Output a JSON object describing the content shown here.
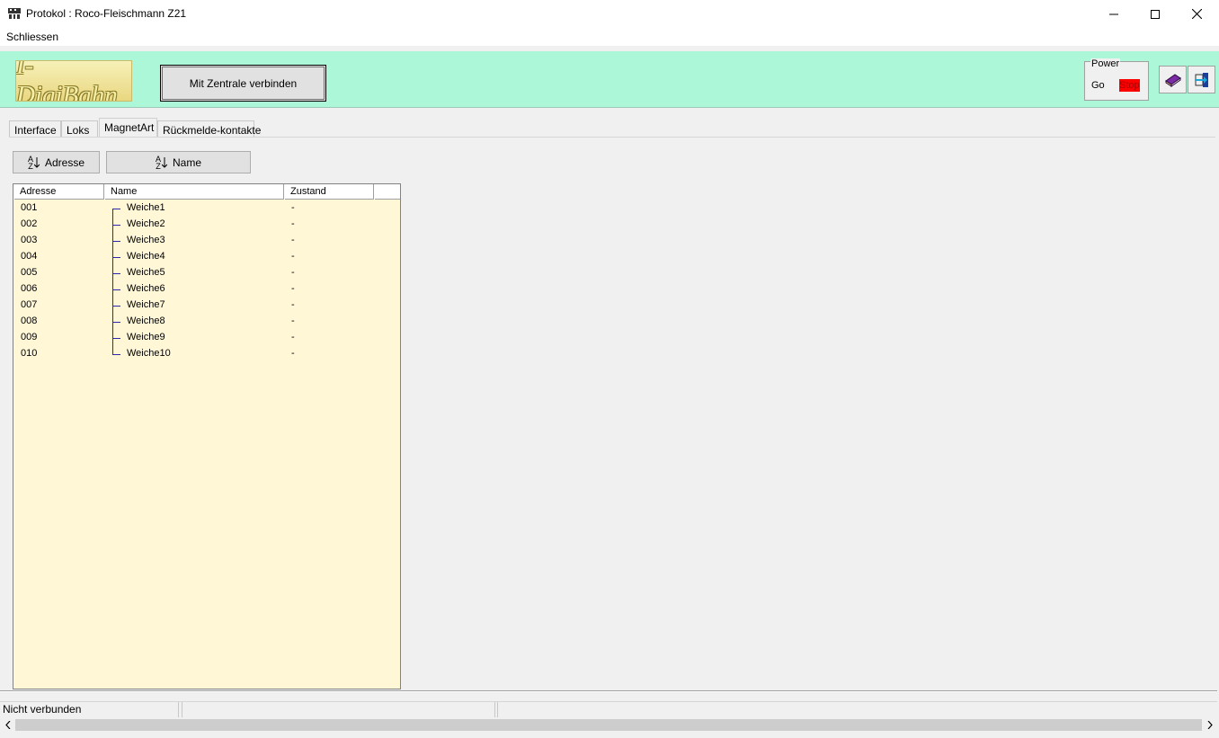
{
  "window": {
    "title": "Protokol : Roco-Fleischmann Z21",
    "min_icon": "minimize-icon",
    "max_icon": "maximize-icon",
    "close_icon": "close-icon"
  },
  "menu": {
    "schliessen": "Schliessen"
  },
  "header": {
    "logo_text": "I-DigiBahn",
    "connect_button": "Mit Zentrale verbinden",
    "power_label": "Power",
    "power_go": "Go",
    "power_stop": "Stop",
    "book_icon": "book-icon",
    "exit_icon": "exit-door-icon",
    "accent_color": "#adf7d9",
    "stop_color": "#ff0000"
  },
  "tabs": [
    {
      "label": "Interface"
    },
    {
      "label": "Loks"
    },
    {
      "label": "MagnetArt",
      "active": true
    },
    {
      "label": "Rückmelde-kontakte"
    }
  ],
  "sort_buttons": {
    "adresse": "Adresse",
    "name": "Name",
    "sort_glyph_top": "A",
    "sort_glyph_bottom": "Z"
  },
  "list": {
    "background": "#fff7d6",
    "columns": [
      "Adresse",
      "Name",
      "Zustand",
      ""
    ],
    "rows": [
      {
        "adresse": "001",
        "name": "Weiche1",
        "zustand": "-"
      },
      {
        "adresse": "002",
        "name": "Weiche2",
        "zustand": "-"
      },
      {
        "adresse": "003",
        "name": "Weiche3",
        "zustand": "-"
      },
      {
        "adresse": "004",
        "name": "Weiche4",
        "zustand": "-"
      },
      {
        "adresse": "005",
        "name": "Weiche5",
        "zustand": "-"
      },
      {
        "adresse": "006",
        "name": "Weiche6",
        "zustand": "-"
      },
      {
        "adresse": "007",
        "name": "Weiche7",
        "zustand": "-"
      },
      {
        "adresse": "008",
        "name": "Weiche8",
        "zustand": "-"
      },
      {
        "adresse": "009",
        "name": "Weiche9",
        "zustand": "-"
      },
      {
        "adresse": "010",
        "name": "Weiche10",
        "zustand": "-"
      }
    ]
  },
  "status": {
    "connection": "Nicht verbunden"
  }
}
